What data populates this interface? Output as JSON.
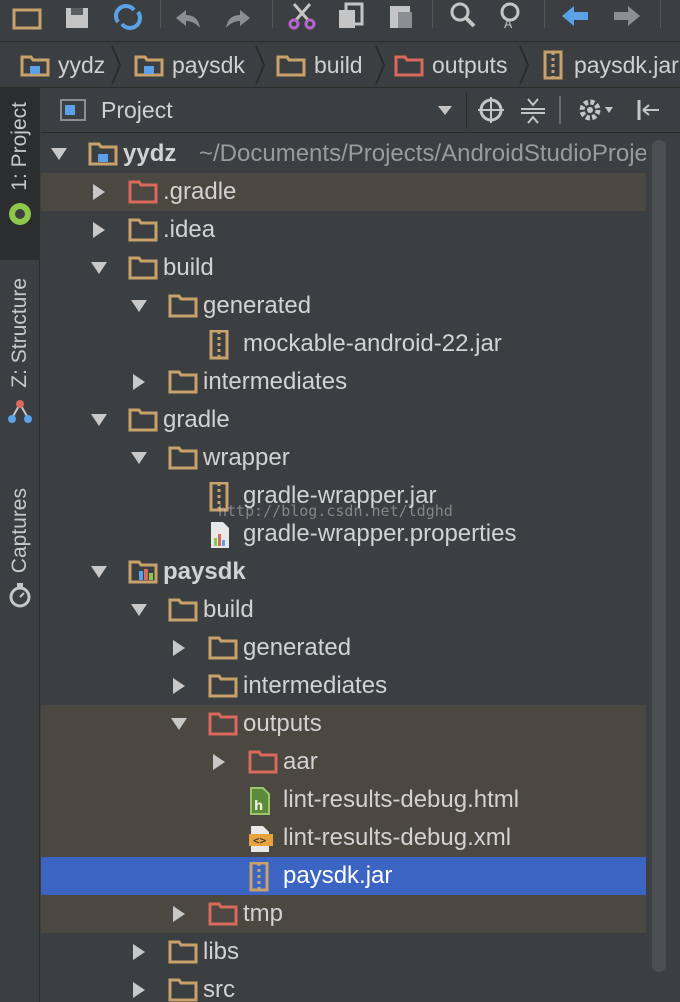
{
  "breadcrumb": [
    {
      "label": "yydz",
      "icon": "module-folder-icon"
    },
    {
      "label": "paysdk",
      "icon": "module-folder-icon"
    },
    {
      "label": "build",
      "icon": "folder-icon"
    },
    {
      "label": "outputs",
      "icon": "excluded-folder-icon"
    },
    {
      "label": "paysdk.jar",
      "icon": "jar-icon"
    }
  ],
  "stripe": {
    "project_label": "1: Project",
    "structure_label": "Z: Structure",
    "captures_label": "Captures"
  },
  "project_panel": {
    "view_mode": "Project"
  },
  "tree": {
    "root_label": "yydz",
    "root_path": "~/Documents/Projects/AndroidStudioProjects/yydz",
    "rows": [
      {
        "label": ".gradle",
        "icon": "excluded-folder-icon",
        "expanded": false
      },
      {
        "label": ".idea",
        "icon": "folder-icon",
        "expanded": false
      },
      {
        "label": "build",
        "icon": "folder-icon",
        "expanded": true
      },
      {
        "label": "generated",
        "icon": "folder-icon",
        "expanded": true
      },
      {
        "label": "mockable-android-22.jar",
        "icon": "jar-icon"
      },
      {
        "label": "intermediates",
        "icon": "folder-icon",
        "expanded": false
      },
      {
        "label": "gradle",
        "icon": "folder-icon",
        "expanded": true
      },
      {
        "label": "wrapper",
        "icon": "folder-icon",
        "expanded": true
      },
      {
        "label": "gradle-wrapper.jar",
        "icon": "jar-icon"
      },
      {
        "label": "gradle-wrapper.properties",
        "icon": "properties-file-icon"
      },
      {
        "label": "paysdk",
        "icon": "module-folder-icon",
        "expanded": true
      },
      {
        "label": "build",
        "icon": "folder-icon",
        "expanded": true
      },
      {
        "label": "generated",
        "icon": "folder-icon",
        "expanded": false
      },
      {
        "label": "intermediates",
        "icon": "folder-icon",
        "expanded": false
      },
      {
        "label": "outputs",
        "icon": "excluded-folder-icon",
        "expanded": true
      },
      {
        "label": "aar",
        "icon": "excluded-folder-icon",
        "expanded": false
      },
      {
        "label": "lint-results-debug.html",
        "icon": "html-file-icon"
      },
      {
        "label": "lint-results-debug.xml",
        "icon": "xml-file-icon"
      },
      {
        "label": "paysdk.jar",
        "icon": "jar-icon",
        "selected": true
      },
      {
        "label": "tmp",
        "icon": "excluded-folder-icon",
        "expanded": false
      },
      {
        "label": "libs",
        "icon": "folder-icon",
        "expanded": false
      },
      {
        "label": "src",
        "icon": "folder-icon",
        "expanded": false
      }
    ]
  },
  "watermark": "http://blog.csdn.net/ldghd",
  "colors": {
    "background": "#3c3f41",
    "selection": "#3c64c3",
    "excluded_row": "#4b4741",
    "folder": "#c9a26b",
    "excluded_folder": "#d8695c",
    "toolbar_accent": "#5aa1e8"
  }
}
